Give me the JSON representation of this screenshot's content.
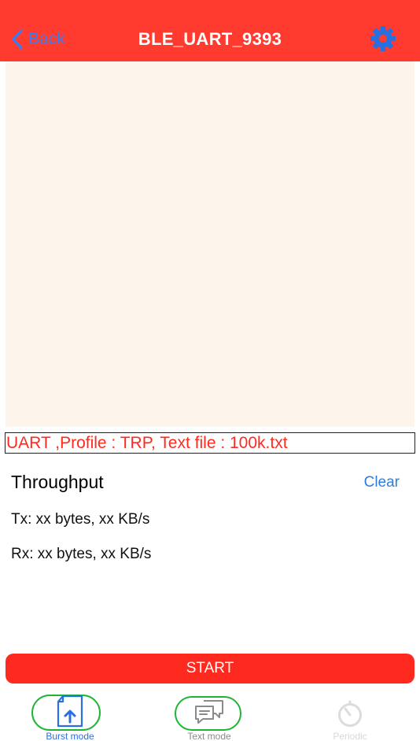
{
  "navbar": {
    "back_label": "Back",
    "title": "BLE_UART_9393",
    "settings_icon": "gear-icon"
  },
  "profile": {
    "text": "UART ,Profile : TRP, Text file : 100k.txt"
  },
  "throughput": {
    "title": "Throughput",
    "clear_label": "Clear",
    "tx": "Tx: xx bytes, xx KB/s",
    "rx": "Rx: xx bytes, xx KB/s"
  },
  "start_label": "START",
  "tabs": [
    {
      "label": "Burst mode",
      "icon": "file-upload-icon",
      "state": "selected"
    },
    {
      "label": "Text mode",
      "icon": "chat-bubbles-icon",
      "state": "normal"
    },
    {
      "label": "Periodic",
      "icon": "timer-icon",
      "state": "disabled"
    }
  ],
  "colors": {
    "navbar": "#ff3b2f",
    "accent_blue": "#2e7ddb",
    "profile_text": "#ff2a1f",
    "start_button": "#ff2a1f",
    "log_background": "#fdf5ec",
    "tab_highlight": "#1db534"
  }
}
